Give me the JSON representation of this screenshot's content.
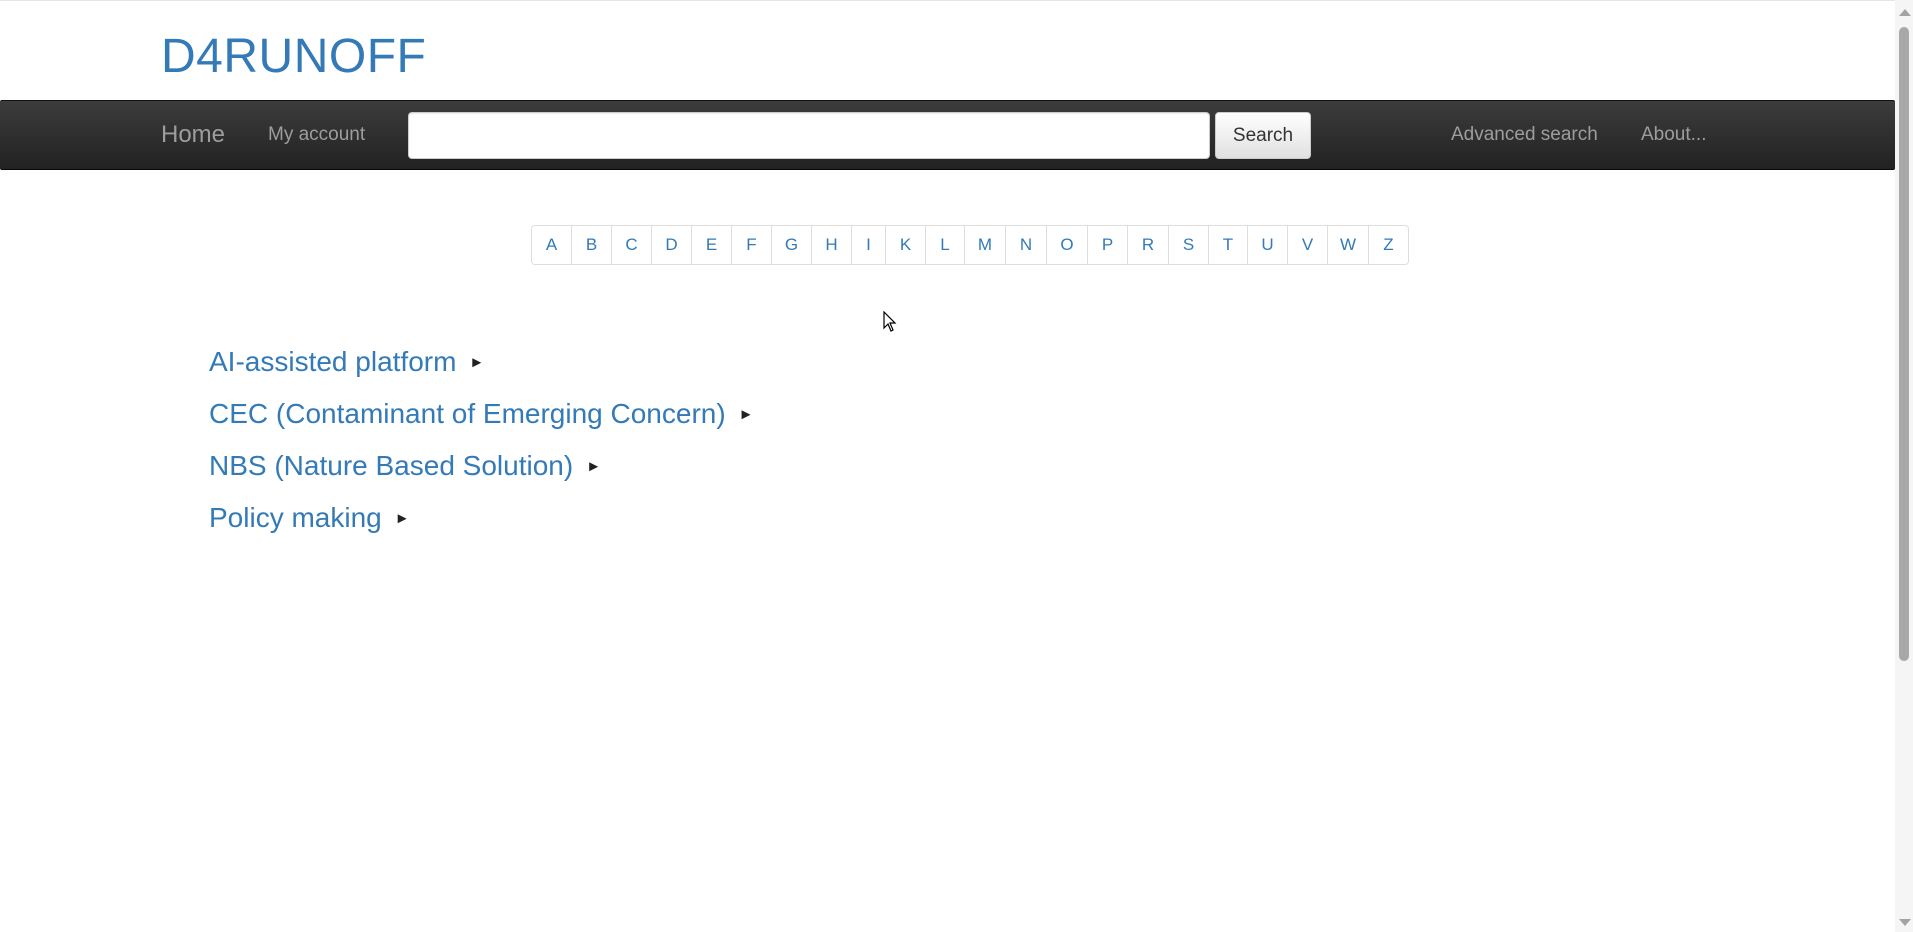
{
  "brand": {
    "title": "D4RUNOFF"
  },
  "nav": {
    "home": "Home",
    "my_account": "My account",
    "search": {
      "value": "",
      "placeholder": "",
      "button_label": "Search"
    },
    "advanced_search": "Advanced search",
    "about": "About..."
  },
  "alphabet": [
    "A",
    "B",
    "C",
    "D",
    "E",
    "F",
    "G",
    "H",
    "I",
    "K",
    "L",
    "M",
    "N",
    "O",
    "P",
    "R",
    "S",
    "T",
    "U",
    "V",
    "W",
    "Z"
  ],
  "topics": [
    {
      "label": "AI-assisted platform",
      "toggle": "►"
    },
    {
      "label": "CEC (Contaminant of Emerging Concern)",
      "toggle": "►"
    },
    {
      "label": "NBS (Nature Based Solution)",
      "toggle": "►"
    },
    {
      "label": "Policy making",
      "toggle": "►"
    }
  ],
  "colors": {
    "link": "#337ab7",
    "navbar_dark": "#222222",
    "nav_text": "#9d9d9d"
  }
}
